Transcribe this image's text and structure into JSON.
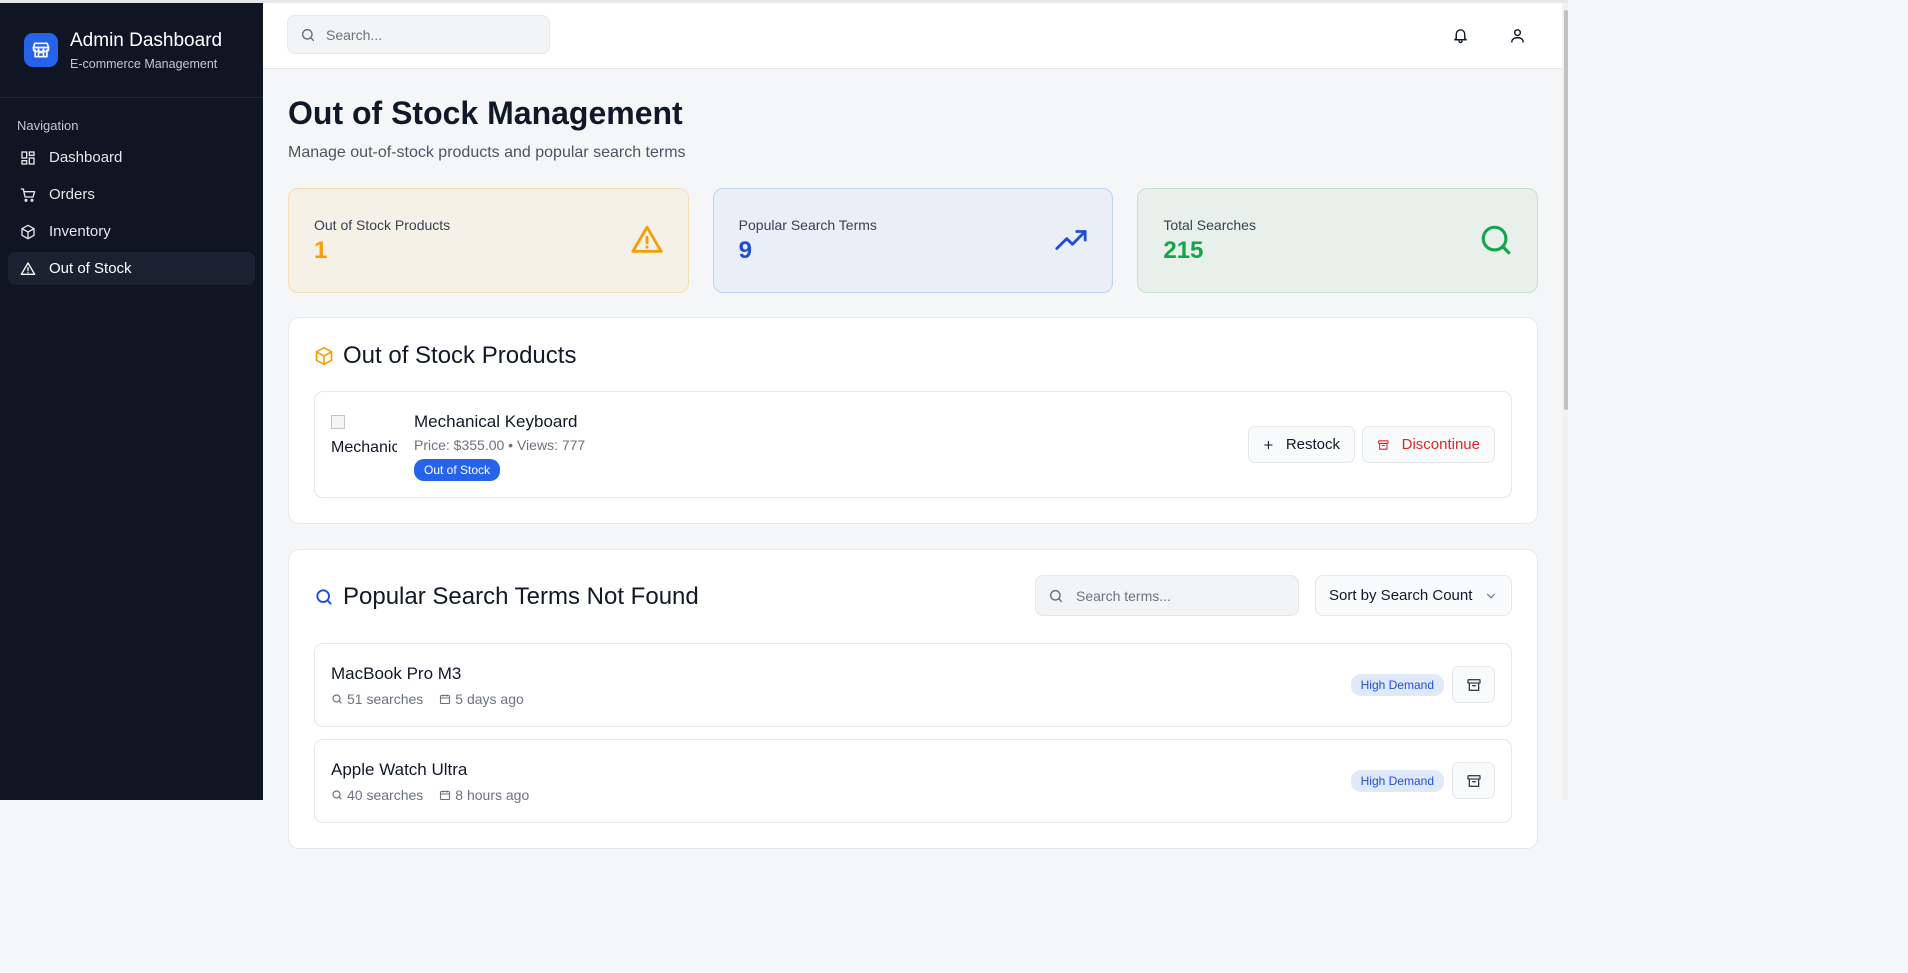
{
  "sidebar": {
    "title": "Admin Dashboard",
    "subtitle": "E-commerce Management",
    "nav_heading": "Navigation",
    "items": [
      {
        "label": "Dashboard",
        "icon": "dashboard-grid-icon"
      },
      {
        "label": "Orders",
        "icon": "cart-icon"
      },
      {
        "label": "Inventory",
        "icon": "box-icon"
      },
      {
        "label": "Out of Stock",
        "icon": "warning-triangle-icon",
        "active": true
      }
    ]
  },
  "header": {
    "search_placeholder": "Search..."
  },
  "page": {
    "title": "Out of Stock Management",
    "subtitle": "Manage out-of-stock products and popular search terms"
  },
  "stats": [
    {
      "label": "Out of Stock Products",
      "value": "1",
      "icon": "warning-triangle-icon",
      "color": "#f59e0b"
    },
    {
      "label": "Popular Search Terms",
      "value": "9",
      "icon": "trending-up-icon",
      "color": "#1d4ed8"
    },
    {
      "label": "Total Searches",
      "value": "215",
      "icon": "search-icon",
      "color": "#16a34a"
    }
  ],
  "out_of_stock": {
    "title": "Out of Stock Products",
    "products": [
      {
        "image_alt": "Mechanical Keyboard",
        "name": "Mechanical Keyboard",
        "meta": "Price: $355.00 • Views: 777",
        "badge": "Out of Stock",
        "restock_label": "Restock",
        "discontinue_label": "Discontinue"
      }
    ]
  },
  "search_terms": {
    "title": "Popular Search Terms Not Found",
    "filter_placeholder": "Search terms...",
    "sort_label": "Sort by Search Count",
    "terms": [
      {
        "name": "MacBook Pro M3",
        "searches": "51 searches",
        "when": "5 days ago",
        "badge": "High Demand"
      },
      {
        "name": "Apple Watch Ultra",
        "searches": "40 searches",
        "when": "8 hours ago",
        "badge": "High Demand"
      }
    ]
  },
  "colors": {
    "sidebar_bg": "#0f1522",
    "accent": "#2563eb",
    "danger": "#dc2626",
    "warning": "#f59e0b",
    "success": "#16a34a"
  }
}
